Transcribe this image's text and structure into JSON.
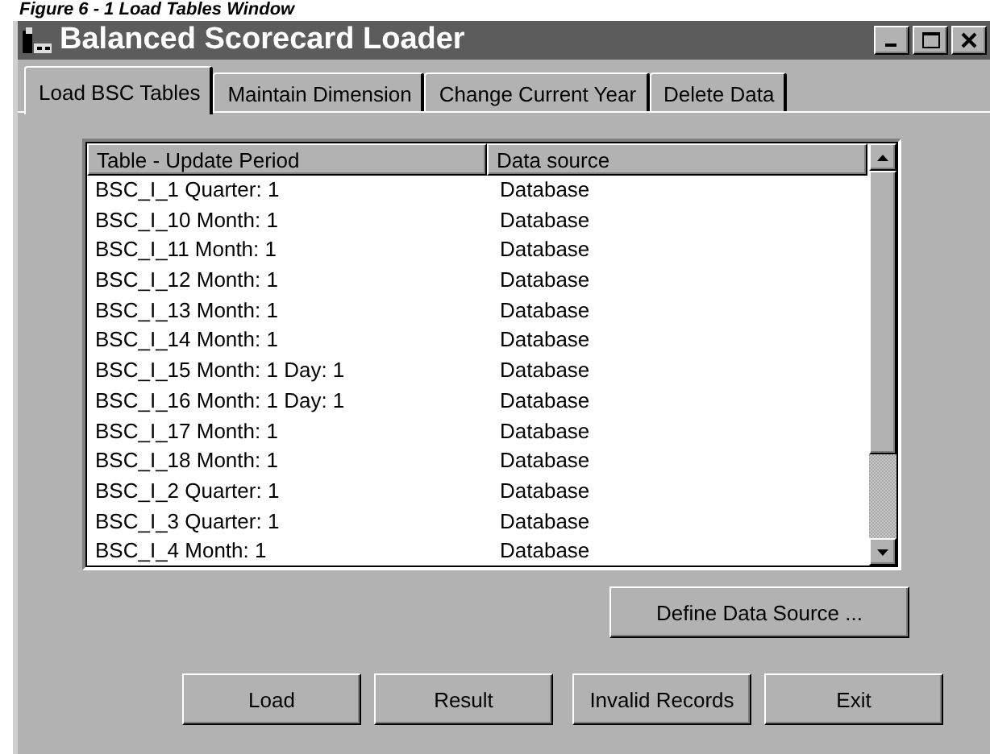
{
  "caption": "Figure 6 - 1 Load Tables Window",
  "window": {
    "title": "Balanced Scorecard Loader"
  },
  "tabs": [
    {
      "label": "Load BSC Tables",
      "selected": true
    },
    {
      "label": "Maintain Dimension",
      "selected": false
    },
    {
      "label": "Change Current Year",
      "selected": false
    },
    {
      "label": "Delete Data",
      "selected": false
    }
  ],
  "table": {
    "columns": [
      "Table - Update Period",
      "Data source"
    ],
    "rows": [
      [
        "BSC_I_1 Quarter: 1",
        "Database"
      ],
      [
        "BSC_I_10 Month: 1",
        "Database"
      ],
      [
        "BSC_I_11 Month: 1",
        "Database"
      ],
      [
        "BSC_I_12 Month: 1",
        "Database"
      ],
      [
        "BSC_I_13 Month: 1",
        "Database"
      ],
      [
        "BSC_I_14 Month: 1",
        "Database"
      ],
      [
        "BSC_I_15 Month: 1 Day: 1",
        "Database"
      ],
      [
        "BSC_I_16 Month: 1 Day: 1",
        "Database"
      ],
      [
        "BSC_I_17 Month: 1",
        "Database"
      ],
      [
        "BSC_I_18 Month: 1",
        "Database"
      ],
      [
        "BSC_I_2 Quarter: 1",
        "Database"
      ],
      [
        "BSC_I_3 Quarter: 1",
        "Database"
      ],
      [
        "BSC_I_4 Month: 1",
        "Database"
      ]
    ]
  },
  "define_button": "Define Data Source ...",
  "buttons": [
    "Load",
    "Result",
    "Invalid Records",
    "Exit"
  ]
}
